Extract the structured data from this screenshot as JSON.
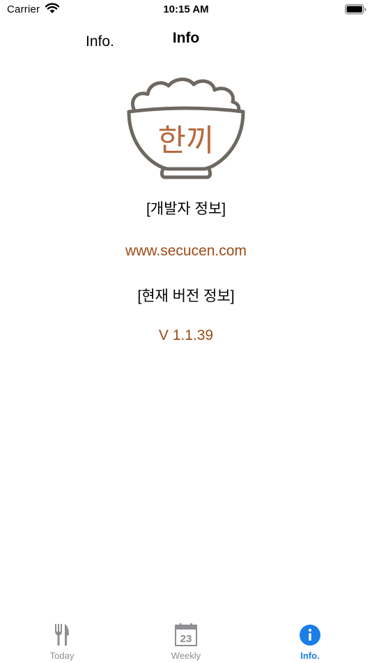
{
  "status_bar": {
    "carrier": "Carrier",
    "time": "10:15 AM"
  },
  "nav": {
    "back_label": "Info.",
    "title": "Info"
  },
  "logo": {
    "text": "한끼"
  },
  "content": {
    "developer_label": "[개발자 정보]",
    "website": "www.secucen.com",
    "version_label": "[현재 버전 정보]",
    "version": "V 1.1.39"
  },
  "tabs": [
    {
      "label": "Today",
      "icon": "fork-knife-icon",
      "selected": false
    },
    {
      "label": "Weekly",
      "icon": "calendar-icon",
      "selected": false,
      "calendar_day": "23"
    },
    {
      "label": "Info.",
      "icon": "info-icon",
      "selected": true
    }
  ],
  "colors": {
    "accent": "#1a7ee8",
    "link_brown": "#9a4b17",
    "logo_text": "#b66a3e",
    "logo_outline": "#6e6863"
  }
}
